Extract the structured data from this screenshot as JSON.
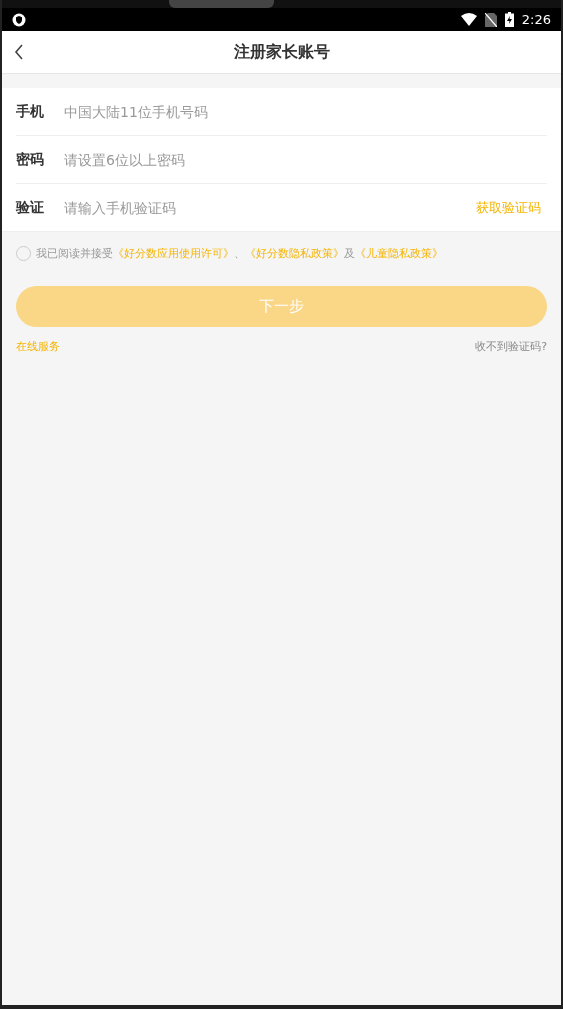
{
  "status_bar": {
    "time": "2:26"
  },
  "header": {
    "title": "注册家长账号"
  },
  "fields": [
    {
      "label": "手机",
      "placeholder": "中国大陆11位手机号码",
      "kind": "text"
    },
    {
      "label": "密码",
      "placeholder": "请设置6位以上密码",
      "kind": "password"
    },
    {
      "label": "验证",
      "placeholder": "请输入手机验证码",
      "kind": "code",
      "action": "获取验证码"
    }
  ],
  "agreement": {
    "checked": false,
    "parts": [
      {
        "text": "我已阅读并接受",
        "kind": "plain"
      },
      {
        "text": "《好分数应用使用许可》",
        "kind": "link"
      },
      {
        "text": "、",
        "kind": "plain"
      },
      {
        "text": "《好分数隐私政策》",
        "kind": "link"
      },
      {
        "text": "及",
        "kind": "plain"
      },
      {
        "text": "《儿童隐私政策》",
        "kind": "link"
      }
    ]
  },
  "next_button": {
    "label": "下一步",
    "disabled": true
  },
  "links": {
    "left": "在线服务",
    "right": "收不到验证码?"
  }
}
